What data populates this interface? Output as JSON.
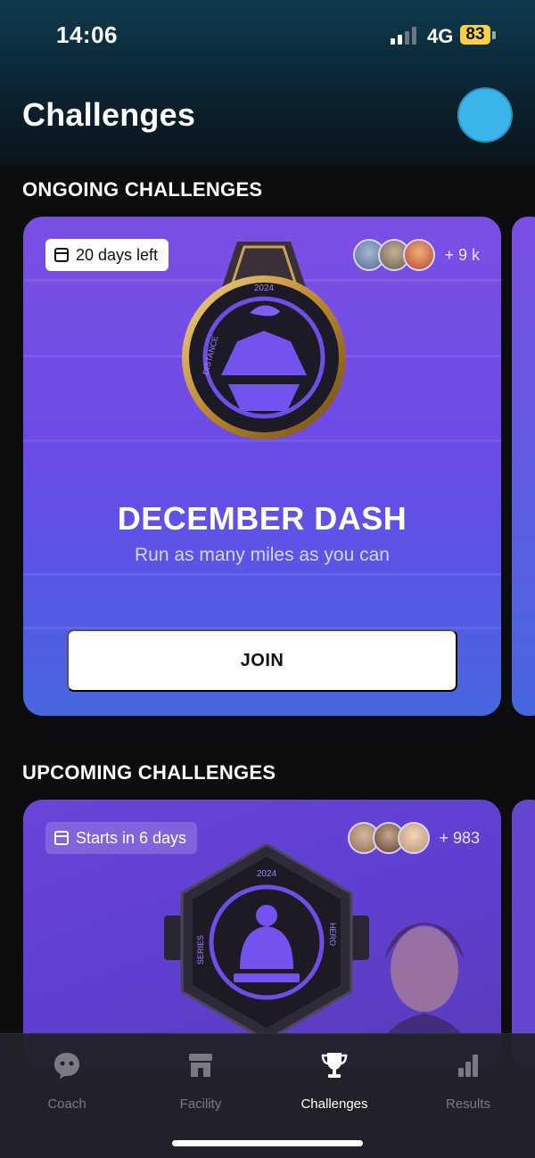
{
  "status_bar": {
    "time": "14:06",
    "network": "4G",
    "battery": "83"
  },
  "header": {
    "title": "Challenges"
  },
  "ongoing": {
    "section_title": "ONGOING CHALLENGES",
    "card": {
      "badge": "20 days left",
      "participants_more": "+ 9 k",
      "medal_year": "2024",
      "medal_label": "DISTANCE",
      "title": "DECEMBER DASH",
      "subtitle": "Run as many miles as you can",
      "join_label": "JOIN"
    }
  },
  "upcoming": {
    "section_title": "UPCOMING CHALLENGES",
    "card": {
      "badge": "Starts in 6 days",
      "participants_more": "+ 983",
      "medal_year": "2024",
      "medal_left": "SERIES",
      "medal_right": "HERO"
    }
  },
  "tabs": [
    {
      "label": "Coach",
      "icon": "chat-face-icon"
    },
    {
      "label": "Facility",
      "icon": "storefront-icon"
    },
    {
      "label": "Challenges",
      "icon": "trophy-icon",
      "active": true
    },
    {
      "label": "Results",
      "icon": "bar-chart-icon"
    }
  ],
  "colors": {
    "card_purple": "#6d4be6",
    "accent_blue": "#3bb4ea",
    "battery": "#f7d046"
  }
}
